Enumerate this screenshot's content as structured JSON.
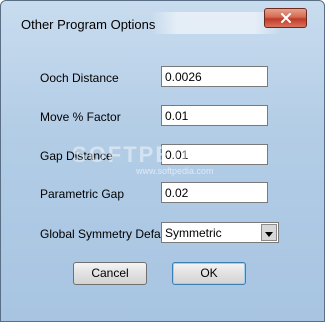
{
  "window": {
    "title": "Other Program Options"
  },
  "fields": [
    {
      "label": "Ooch Distance",
      "value": "0.0026"
    },
    {
      "label": "Move % Factor",
      "value": "0.01"
    },
    {
      "label": "Gap Distance",
      "value": "0.01"
    },
    {
      "label": "Parametric Gap",
      "value": "0.02"
    }
  ],
  "symmetry": {
    "label": "Global Symmetry Default",
    "selected": "Symmetric"
  },
  "buttons": {
    "cancel": "Cancel",
    "ok": "OK"
  },
  "watermark": {
    "text": "SOFTPEDIA",
    "url": "www.softpedia.com"
  },
  "icons": {
    "close": "close-icon",
    "dropdown": "chevron-down-icon"
  },
  "colors": {
    "client_background": "#0aa5a5",
    "close_button": "#c0392b"
  }
}
